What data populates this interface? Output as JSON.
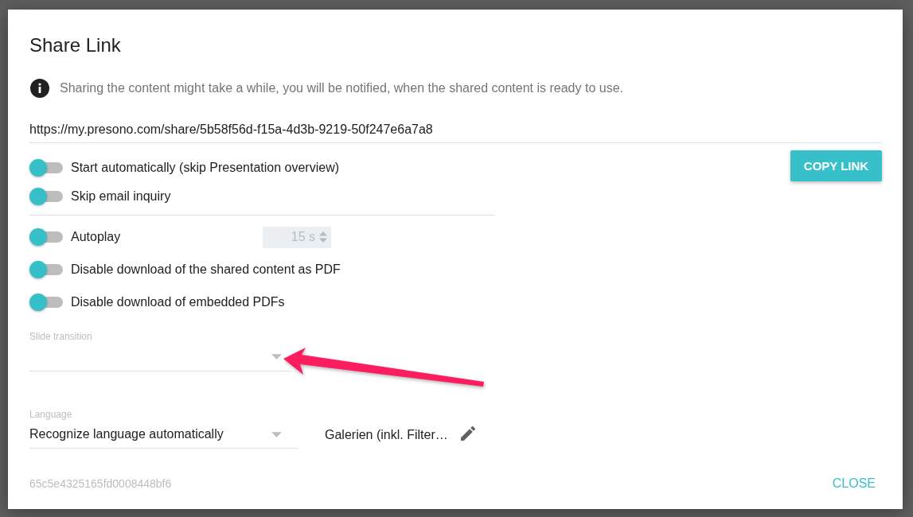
{
  "dialog": {
    "title": "Share Link",
    "info": "Sharing the content might take a while, you will be notified, when the shared content is ready to use.",
    "link": {
      "value": "https://my.presono.com/share/5b58f56d-f15a-4d3b-9219-50f247e6a7a8"
    },
    "copy_button": "COPY LINK",
    "toggle_groups": [
      {
        "toggles": [
          {
            "label": "Start automatically (skip Presentation overview)",
            "on": false
          },
          {
            "label": "Skip email inquiry",
            "on": false
          }
        ]
      },
      {
        "toggles": [
          {
            "label": "Autoplay",
            "on": false,
            "interval": {
              "value": "15 s",
              "disabled": true
            }
          },
          {
            "label": "Disable download of the shared content as PDF",
            "on": false
          },
          {
            "label": "Disable download of embedded PDFs",
            "on": false
          }
        ]
      }
    ],
    "slide_transition": {
      "label": "Slide transition"
    },
    "language": {
      "label": "Language",
      "value": "Recognize language automatically"
    },
    "gallery_setting": {
      "text": "Galerien (inkl. Filter…"
    },
    "footer": {
      "id": "65c5e4325165fd0008448bf6",
      "close_button": "CLOSE"
    }
  }
}
